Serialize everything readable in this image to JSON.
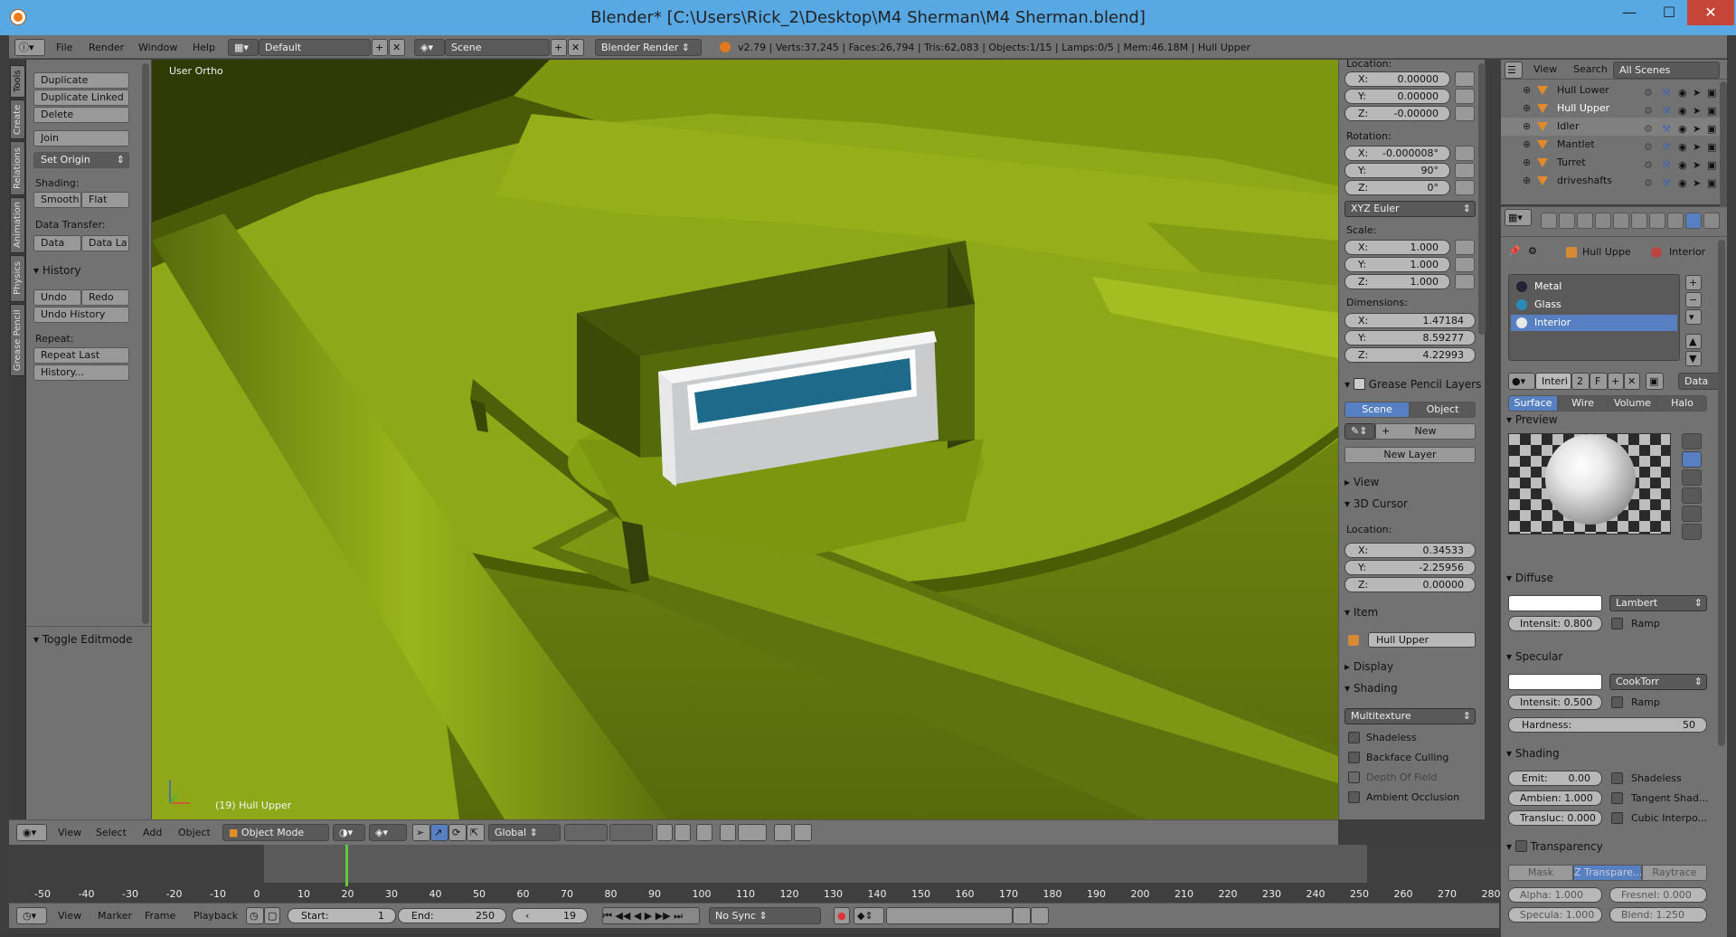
{
  "window": {
    "title": "Blender* [C:\\Users\\Rick_2\\Desktop\\M4 Sherman\\M4 Sherman.blend]"
  },
  "info_header": {
    "menus": [
      "File",
      "Render",
      "Window",
      "Help"
    ],
    "screen_layout": "Default",
    "scene": "Scene",
    "render_engine": "Blender Render",
    "stats": "v2.79 | Verts:37,245 | Faces:26,794 | Tris:62,083 | Objects:1/15 | Lamps:0/5 | Mem:46.18M | Hull Upper"
  },
  "toolshelf": {
    "tabs": [
      "Tools",
      "Create",
      "Relations",
      "Animation",
      "Physics",
      "Grease Pencil"
    ],
    "buttons": {
      "duplicate": "Duplicate",
      "duplicate_linked": "Duplicate Linked",
      "delete": "Delete",
      "join": "Join",
      "set_origin": "Set Origin"
    },
    "shading_label": "Shading:",
    "smooth": "Smooth",
    "flat": "Flat",
    "data_transfer_label": "Data Transfer:",
    "data": "Data",
    "data_layout": "Data La",
    "history_title": "History",
    "undo": "Undo",
    "redo": "Redo",
    "undo_history": "Undo History",
    "repeat_label": "Repeat:",
    "repeat_last": "Repeat Last",
    "history_btn": "History...",
    "toggle_editmode": "Toggle Editmode"
  },
  "viewport": {
    "view_label": "User Ortho",
    "object_label": "(19) Hull Upper"
  },
  "npanel": {
    "location_label": "Location:",
    "location": {
      "x": "0.00000",
      "y": "0.00000",
      "z": "-0.00000"
    },
    "rotation_label": "Rotation:",
    "rotation": {
      "x": "-0.000008°",
      "y": "90°",
      "z": "0°"
    },
    "rotation_mode": "XYZ Euler",
    "scale_label": "Scale:",
    "scale": {
      "x": "1.000",
      "y": "1.000",
      "z": "1.000"
    },
    "dimensions_label": "Dimensions:",
    "dimensions": {
      "x": "1.47184",
      "y": "8.59277",
      "z": "4.22993"
    },
    "axis": {
      "x": "X:",
      "y": "Y:",
      "z": "Z:"
    },
    "grease_title": "Grease Pencil Layers",
    "scene_btn": "Scene",
    "object_btn": "Object",
    "new_btn": "New",
    "new_layer_btn": "New Layer",
    "view_title": "View",
    "cursor_title": "3D Cursor",
    "cursor_location_label": "Location:",
    "cursor": {
      "x": "0.34533",
      "y": "-2.25956",
      "z": "0.00000"
    },
    "item_title": "Item",
    "item_name": "Hull Upper",
    "display_title": "Display",
    "shading_title": "Shading",
    "shading_mode": "Multitexture",
    "shading_options": [
      "Shadeless",
      "Backface Culling",
      "Depth Of Field",
      "Ambient Occlusion"
    ]
  },
  "outliner": {
    "view": "View",
    "search": "Search",
    "filter": "All Scenes",
    "items": [
      "Hull Lower",
      "Hull Upper",
      "Idler",
      "Mantlet",
      "Turret",
      "driveshafts"
    ]
  },
  "properties": {
    "breadcrumb_object": "Hull Uppe",
    "breadcrumb_material": "Interior",
    "slots": [
      "Metal",
      "Glass",
      "Interior"
    ],
    "material_name": "Interi",
    "users": "2",
    "fake": "F",
    "data_link": "Data",
    "tabs": [
      "Surface",
      "Wire",
      "Volume",
      "Halo"
    ],
    "preview_title": "Preview",
    "diffuse_title": "Diffuse",
    "diffuse_shader": "Lambert",
    "diffuse_intensity": "Intensit: 0.800",
    "ramp": "Ramp",
    "specular_title": "Specular",
    "specular_shader": "CookTorr",
    "specular_intensity": "Intensit: 0.500",
    "hardness_label": "Hardness:",
    "hardness": "50",
    "shading_title": "Shading",
    "emit": "Emit:",
    "emit_val": "0.00",
    "ambient": "Ambien: 1.000",
    "translucency": "Transluc: 0.000",
    "shadeless": "Shadeless",
    "tangent": "Tangent Shad...",
    "cubic": "Cubic Interpo...",
    "transparency_title": "Transparency",
    "mask": "Mask",
    "ztransp": "Z Transpare...",
    "raytrace": "Raytrace",
    "alpha": "Alpha:  1.000",
    "fresnel": "Fresnel: 0.000",
    "specula": "Specula: 1.000",
    "blend": "Blend:  1.250"
  },
  "view3d_header": {
    "menus": [
      "View",
      "Select",
      "Add",
      "Object"
    ],
    "mode": "Object Mode",
    "orientation": "Global"
  },
  "timeline": {
    "ticks": [
      "-50",
      "-40",
      "-30",
      "-20",
      "-10",
      "0",
      "10",
      "20",
      "30",
      "40",
      "50",
      "60",
      "70",
      "80",
      "90",
      "100",
      "110",
      "120",
      "130",
      "140",
      "150",
      "160",
      "170",
      "180",
      "190",
      "200",
      "210",
      "220",
      "230",
      "240",
      "250",
      "260",
      "270",
      "280"
    ],
    "menus": [
      "View",
      "Marker",
      "Frame",
      "Playback"
    ],
    "start": "Start:",
    "start_val": "1",
    "end": "End:",
    "end_val": "250",
    "current": "19",
    "sync": "No Sync"
  }
}
